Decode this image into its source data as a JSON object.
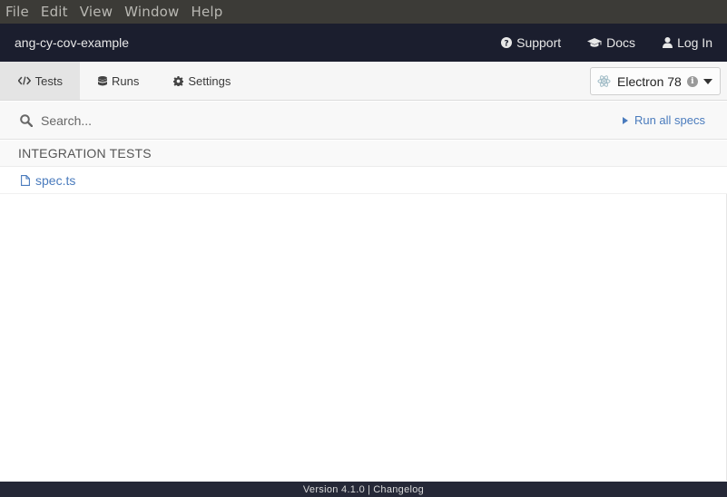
{
  "menubar": {
    "items": [
      "File",
      "Edit",
      "View",
      "Window",
      "Help"
    ]
  },
  "header": {
    "project_name": "ang-cy-cov-example",
    "nav": {
      "support": "Support",
      "docs": "Docs",
      "login": "Log In"
    }
  },
  "tabs": {
    "tests": "Tests",
    "runs": "Runs",
    "settings": "Settings",
    "active": "tests"
  },
  "browser": {
    "selected": "Electron 78",
    "info_glyph": "i"
  },
  "search": {
    "placeholder": "Search...",
    "value": "",
    "run_all_label": "Run all specs"
  },
  "section": {
    "title": "INTEGRATION TESTS"
  },
  "specs": [
    {
      "name": "spec.ts"
    }
  ],
  "footer": {
    "version": "Version 4.1.0",
    "separator": "|",
    "changelog": "Changelog"
  },
  "colors": {
    "menubar_bg": "#3c3b37",
    "header_bg": "#1b1e2e",
    "footer_bg": "#252837",
    "link_blue": "#4a7bbd"
  }
}
